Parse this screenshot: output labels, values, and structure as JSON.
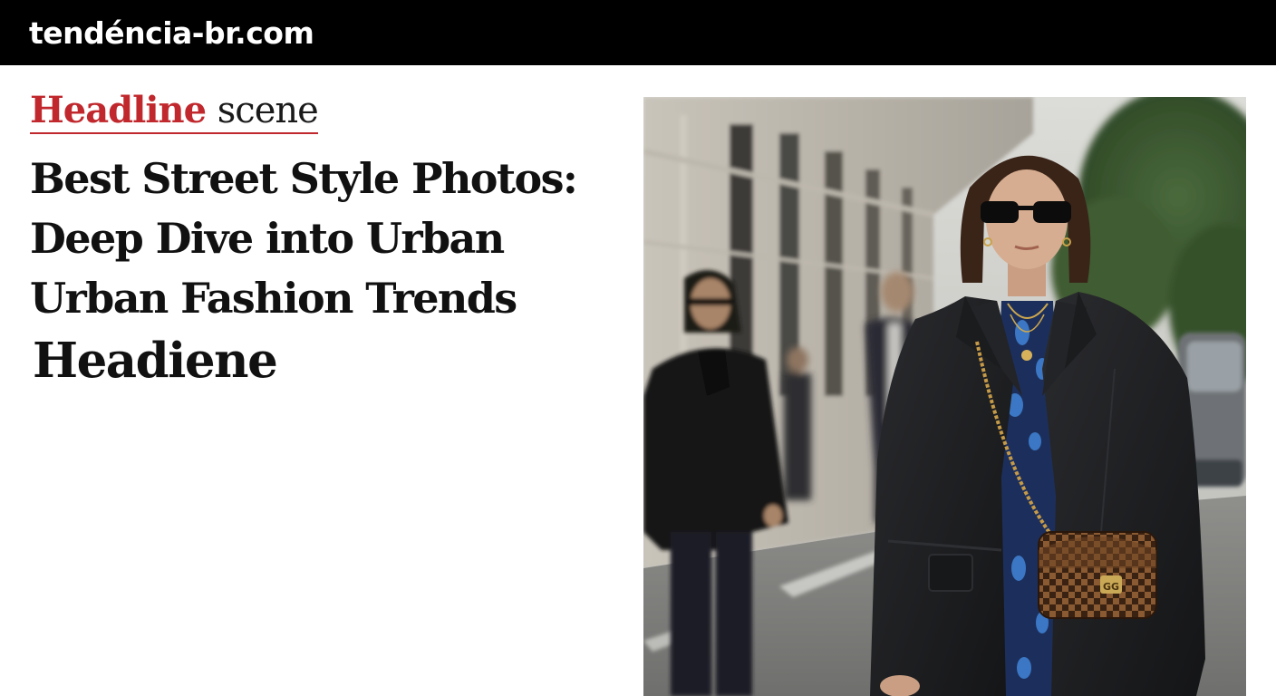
{
  "site": {
    "name": "tendéncia-br.com"
  },
  "article": {
    "kicker_strong": "Headline",
    "kicker_light": "scene",
    "headline_lines": [
      "Best Street Style Photos:",
      "Deep Dive into Urban",
      "Urban Fashion Trends"
    ],
    "subline": "Headiene"
  },
  "photo": {
    "bag_monogram": "GG"
  },
  "colors": {
    "topbar": "#000000",
    "accent": "#c0282d",
    "text": "#111111"
  }
}
